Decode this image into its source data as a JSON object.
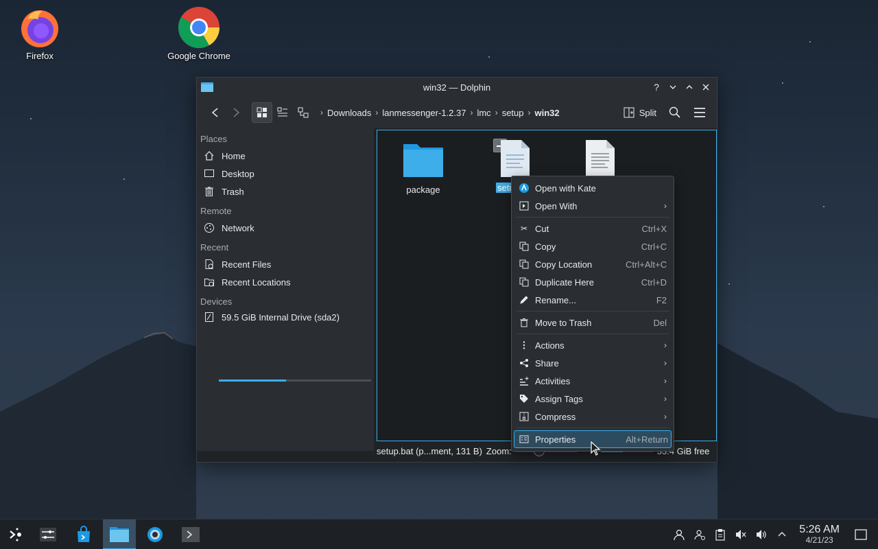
{
  "desktop": {
    "icons": [
      {
        "label": "Firefox",
        "icon": "firefox-icon"
      },
      {
        "label": "Google Chrome",
        "icon": "chrome-icon"
      }
    ]
  },
  "window": {
    "title": "win32 — Dolphin",
    "title_buttons": {
      "help": "?",
      "minimize": "⌄",
      "maximize": "⌃",
      "close": "✕"
    }
  },
  "toolbar": {
    "breadcrumbs": [
      "Downloads",
      "lanmessenger-1.2.37",
      "lmc",
      "setup",
      "win32"
    ],
    "split_label": "Split"
  },
  "sidebar": {
    "places_header": "Places",
    "places": [
      "Home",
      "Desktop",
      "Trash"
    ],
    "remote_header": "Remote",
    "remote": [
      "Network"
    ],
    "recent_header": "Recent",
    "recent": [
      "Recent Files",
      "Recent Locations"
    ],
    "devices_header": "Devices",
    "devices": [
      {
        "label": "59.5 GiB Internal Drive (sda2)",
        "used_fraction": 0.44
      }
    ]
  },
  "files": [
    {
      "name": "package",
      "type": "folder"
    },
    {
      "name": "setup",
      "type": "bat",
      "selected": true
    },
    {
      "name": "",
      "type": "text"
    }
  ],
  "status": {
    "selection": "setup.bat (p...ment, 131 B)",
    "zoom_label": "Zoom:",
    "free_space": "33.4 GiB free",
    "free_used_fraction": 0.42
  },
  "context_menu": {
    "groups": [
      [
        {
          "label": "Open with Kate",
          "icon": "kate-icon",
          "shortcut": "",
          "submenu": false
        },
        {
          "label": "Open With",
          "icon": "open-with-icon",
          "shortcut": "",
          "submenu": true
        }
      ],
      [
        {
          "label": "Cut",
          "icon": "cut-icon",
          "shortcut": "Ctrl+X",
          "submenu": false
        },
        {
          "label": "Copy",
          "icon": "copy-icon",
          "shortcut": "Ctrl+C",
          "submenu": false
        },
        {
          "label": "Copy Location",
          "icon": "copy-location-icon",
          "shortcut": "Ctrl+Alt+C",
          "submenu": false
        },
        {
          "label": "Duplicate Here",
          "icon": "duplicate-icon",
          "shortcut": "Ctrl+D",
          "submenu": false
        },
        {
          "label": "Rename...",
          "icon": "rename-icon",
          "shortcut": "F2",
          "submenu": false
        }
      ],
      [
        {
          "label": "Move to Trash",
          "icon": "trash-icon",
          "shortcut": "Del",
          "submenu": false
        }
      ],
      [
        {
          "label": "Actions",
          "icon": "actions-icon",
          "shortcut": "",
          "submenu": true
        },
        {
          "label": "Share",
          "icon": "share-icon",
          "shortcut": "",
          "submenu": true
        },
        {
          "label": "Activities",
          "icon": "activities-icon",
          "shortcut": "",
          "submenu": true
        },
        {
          "label": "Assign Tags",
          "icon": "tag-icon",
          "shortcut": "",
          "submenu": true
        },
        {
          "label": "Compress",
          "icon": "compress-icon",
          "shortcut": "",
          "submenu": true
        }
      ],
      [
        {
          "label": "Properties",
          "icon": "properties-icon",
          "shortcut": "Alt+Return",
          "submenu": false,
          "highlighted": true
        }
      ]
    ]
  },
  "taskbar": {
    "clock_time": "5:26 AM",
    "clock_date": "4/21/23"
  },
  "colors": {
    "accent": "#3daee9",
    "window_bg": "#202326",
    "panel_bg": "#2a2e32"
  }
}
